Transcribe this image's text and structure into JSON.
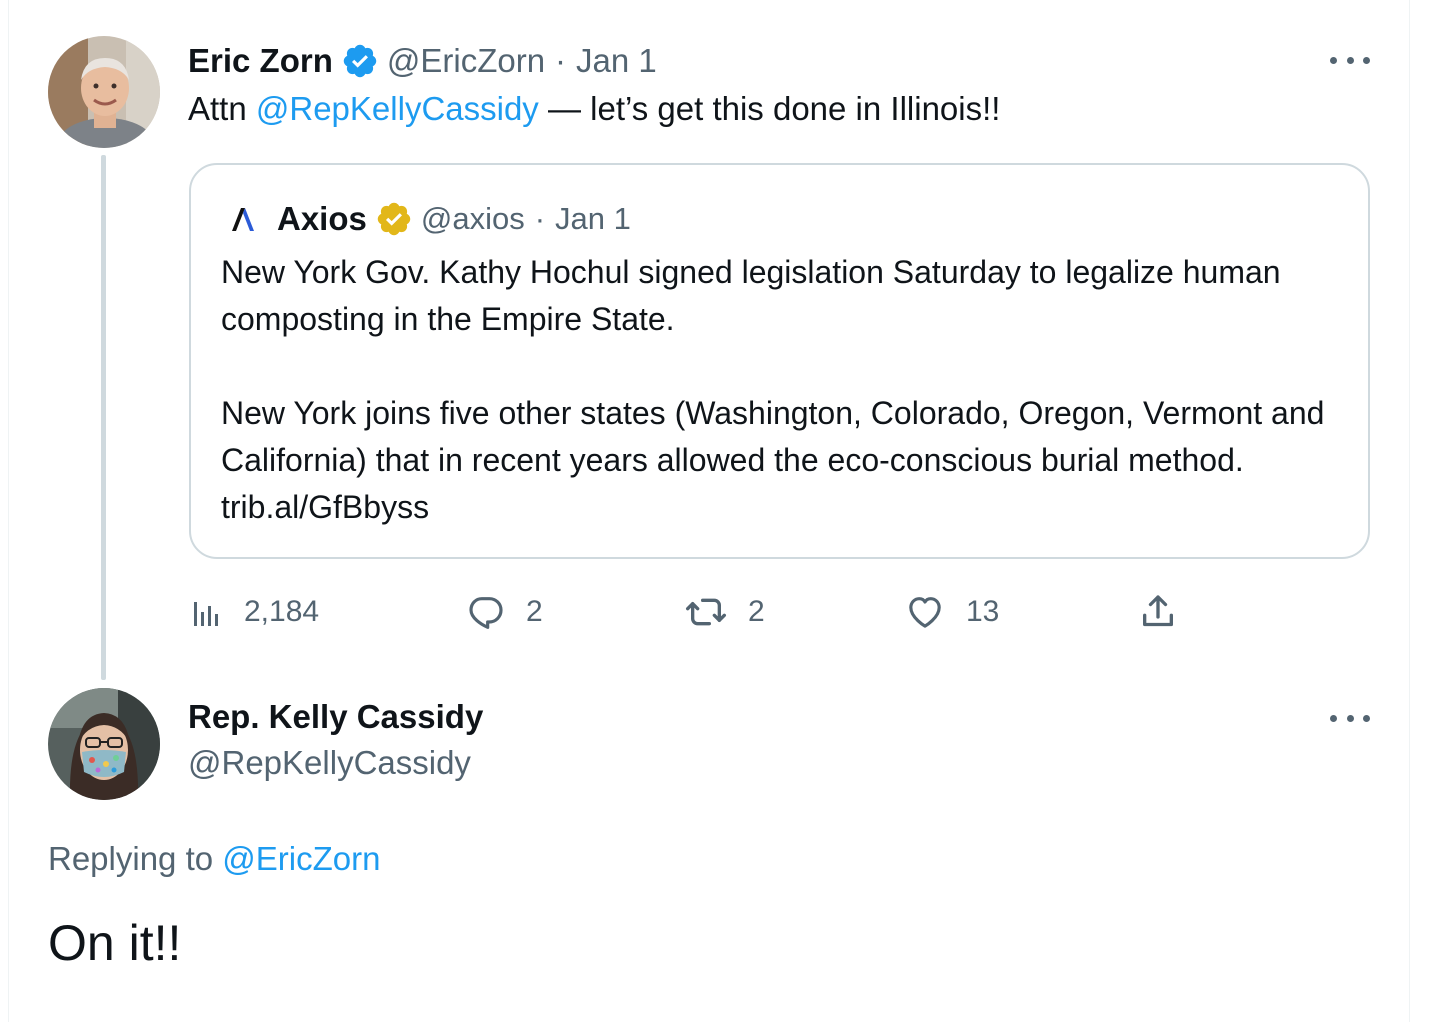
{
  "tweet1": {
    "author_name": "Eric Zorn",
    "handle": "@EricZorn",
    "separator": "·",
    "date": "Jan 1",
    "verified_icon": "verified-badge-blue",
    "text_prefix": "Attn ",
    "mention": "@RepKellyCassidy",
    "text_suffix": " — let’s get this done in Illinois!!",
    "quote": {
      "author_name": "Axios",
      "handle": "@axios",
      "separator": "·",
      "date": "Jan 1",
      "verified_icon": "verified-badge-gold",
      "logo_icon": "axios-logo",
      "paragraph1": "New York Gov. Kathy Hochul signed legislation Saturday to legalize human composting in the Empire State.",
      "paragraph2": "New York joins five other states (Washington, Colorado, Oregon, Vermont and California) that in recent years allowed the eco-conscious burial method. trib.al/GfBbyss"
    },
    "actions": {
      "views": "2,184",
      "replies": "2",
      "retweets": "2",
      "likes": "13"
    }
  },
  "tweet2": {
    "author_name": "Rep. Kelly Cassidy",
    "handle": "@RepKellyCassidy",
    "replying_prefix": "Replying to ",
    "replying_to": "@EricZorn",
    "text": "On it!!"
  },
  "colors": {
    "link_blue": "#1d9bf0",
    "secondary_text": "#536471",
    "border": "#cfd9de",
    "verified_gold": "#e2b719"
  }
}
